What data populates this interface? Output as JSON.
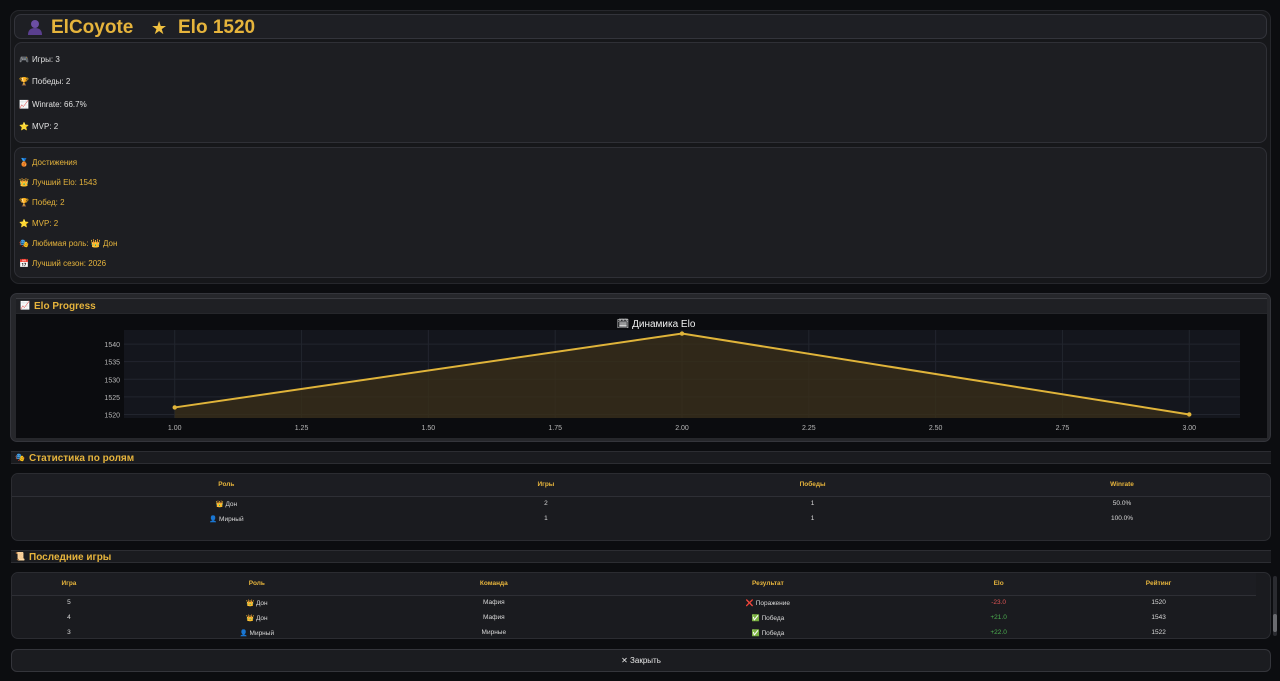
{
  "header": {
    "name": "ElCoyote",
    "elo_label": "Elo 1520"
  },
  "stats": [
    {
      "icon": "gamepad-icon",
      "label": "Игры: 3"
    },
    {
      "icon": "trophy-icon",
      "label": "Победы: 2"
    },
    {
      "icon": "chart-icon",
      "label": "Winrate: 66.7%"
    },
    {
      "icon": "star-icon",
      "label": "MVP: 2"
    }
  ],
  "achievements": [
    {
      "icon": "medal-icon",
      "label": "Достижения"
    },
    {
      "icon": "crown-icon",
      "label": "Лучший Elo: 1543"
    },
    {
      "icon": "trophy-icon",
      "label": "Побед: 2"
    },
    {
      "icon": "star-icon",
      "label": "MVP: 2"
    },
    {
      "icon": "masks-icon",
      "label": "Любимая роль: 👑 Дон"
    },
    {
      "icon": "calendar-icon",
      "label": "Лучший сезон: 2026"
    }
  ],
  "elo_section": {
    "title": "Elo Progress"
  },
  "chart_data": {
    "type": "area",
    "title": "🗓 Динамика Elo",
    "x": [
      1,
      2,
      3
    ],
    "y": [
      1522,
      1543,
      1520
    ],
    "xlim": [
      0.9,
      3.1
    ],
    "ylim": [
      1519,
      1544
    ],
    "xticks": [
      "1.00",
      "1.25",
      "1.50",
      "1.75",
      "2.00",
      "2.25",
      "2.50",
      "2.75",
      "3.00"
    ],
    "xtick_values": [
      1,
      1.25,
      1.5,
      1.75,
      2,
      2.25,
      2.5,
      2.75,
      3
    ],
    "yticks": [
      "1520",
      "1525",
      "1530",
      "1535",
      "1540"
    ],
    "ytick_values": [
      1520,
      1525,
      1530,
      1535,
      1540
    ],
    "grid": true,
    "line_color": "#e0b43a"
  },
  "roles_section": {
    "title": "Статистика по ролям",
    "columns": [
      "Роль",
      "Игры",
      "Победы",
      "Winrate"
    ],
    "rows": [
      [
        "👑 Дон",
        "2",
        "1",
        "50.0%"
      ],
      [
        "👤 Мирный",
        "1",
        "1",
        "100.0%"
      ]
    ]
  },
  "games_section": {
    "title": "Последние игры",
    "columns": [
      "Игра",
      "Роль",
      "Команда",
      "Результат",
      "Elo",
      "Рейтинг"
    ],
    "rows": [
      [
        "5",
        "👑 Дон",
        "Мафия",
        "❌ Поражение",
        "-23.0",
        "1520"
      ],
      [
        "4",
        "👑 Дон",
        "Мафия",
        "✅ Победа",
        "+21.0",
        "1543"
      ],
      [
        "3",
        "👤 Мирный",
        "Мирные",
        "✅ Победа",
        "+22.0",
        "1522"
      ]
    ]
  },
  "close_button": {
    "label": "✕ Закрыть"
  },
  "colors": {
    "accent": "#e6b43c",
    "win": "#4caf50",
    "loss": "#e05555"
  }
}
